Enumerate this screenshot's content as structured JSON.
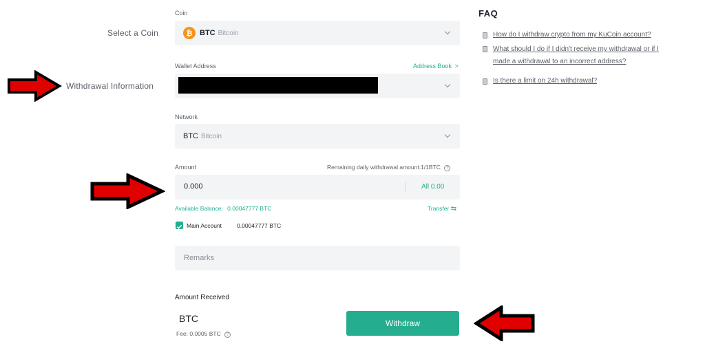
{
  "side_labels": {
    "select_coin": "Select a Coin",
    "withdrawal_info": "Withdrawal Information"
  },
  "coin": {
    "label": "Coin",
    "symbol": "BTC",
    "name": "Bitcoin",
    "icon": "bitcoin-icon",
    "icon_glyph": "₿"
  },
  "wallet": {
    "label": "Wallet Address",
    "address_book": "Address Book",
    "address_book_chevron": ">"
  },
  "network": {
    "label": "Network",
    "symbol": "BTC",
    "name": "Bitcoin"
  },
  "amount": {
    "label": "Amount",
    "remaining": "Remaining daily withdrawal amount:1/1BTC",
    "help_glyph": "?",
    "value": "0.000",
    "all_label": "All",
    "all_value": "0.00",
    "available_label": "Available Balance:",
    "available_value": "0.00047777 BTC",
    "transfer": "Transfer",
    "transfer_glyph": "⇆"
  },
  "account": {
    "checked": true,
    "name": "Main Account",
    "balance": "0.00047777 BTC"
  },
  "remarks": {
    "placeholder": "Remarks"
  },
  "received": {
    "label": "Amount Received",
    "symbol": "BTC",
    "fee": "Fee: 0.0005 BTC",
    "help_glyph": "?"
  },
  "withdraw_button": "Withdraw",
  "faq": {
    "title": "FAQ",
    "items": [
      "How do I withdraw crypto from my KuCoin account?",
      "What should I do if I didn't receive my withdrawal or if I",
      "made a withdrawal to an incorrect address?",
      "Is there a limit on 24h withdrawal?"
    ]
  },
  "colors": {
    "accent": "#24ae8f",
    "btc": "#f7931a",
    "arrow_fill": "#e00000",
    "redaction": "#000000"
  }
}
